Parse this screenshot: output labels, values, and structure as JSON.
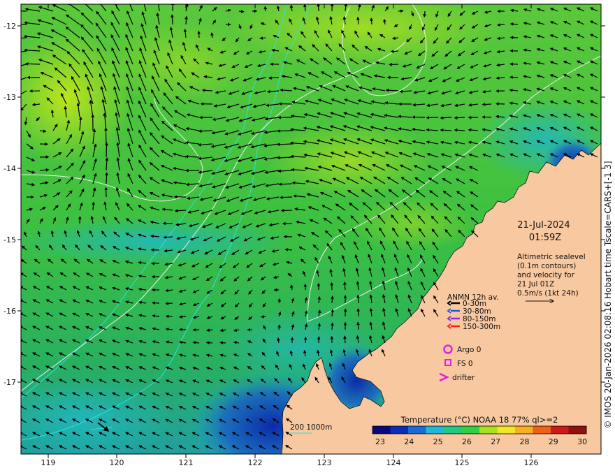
{
  "map": {
    "date": "21-Jul-2024",
    "time": "01:59Z",
    "description_lines": [
      "Altimetric sealevel",
      "(0.1m contours)",
      "and velocity for",
      "21 Jul 01Z",
      "0.5m/s (1kt 24h)"
    ],
    "legend": {
      "title": "ANMN 12h av.",
      "items": [
        {
          "label": "0-30m",
          "color": "#000000"
        },
        {
          "label": "30-80m",
          "color": "#1e5bd6"
        },
        {
          "label": "80-150m",
          "color": "#8a2be2"
        },
        {
          "label": "150-300m",
          "color": "#ff2020"
        }
      ]
    },
    "markers": [
      {
        "label": "Argo 0",
        "shape": "circle",
        "color": "#e020e0"
      },
      {
        "label": "FS 0",
        "shape": "square",
        "color": "#e020e0"
      },
      {
        "label": "drifter",
        "shape": "chevron",
        "color": "#e020e0"
      }
    ],
    "depth_legend": "200  1000m",
    "colorbar": {
      "title": "Temperature (°C) NOAA 18 77% ql>=2",
      "ticks": [
        "23",
        "24",
        "25",
        "26",
        "27",
        "28",
        "29",
        "30"
      ],
      "colors": [
        "#08087a",
        "#0a2cb8",
        "#1a6ad8",
        "#20b8d8",
        "#20c880",
        "#30d040",
        "#a8e020",
        "#f0e820",
        "#f8b020",
        "#f06018",
        "#d01818",
        "#901010"
      ]
    },
    "x_ticks": [
      "119",
      "120",
      "121",
      "122",
      "123",
      "124",
      "125",
      "126"
    ],
    "y_ticks": [
      "-12",
      "-13",
      "-14",
      "-15",
      "-16",
      "-17"
    ],
    "copyright": "© IMOS 20-Jan-2026 02:08:16 Hobart time Tscale=CARS+[-1 3]"
  }
}
